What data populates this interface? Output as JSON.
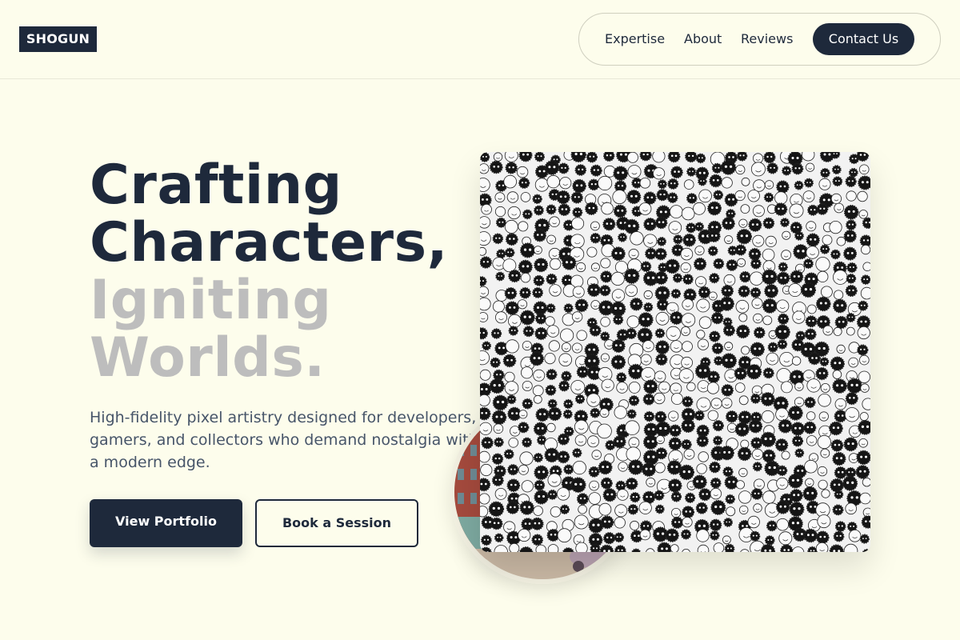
{
  "brand": {
    "logo_text": "SHOGUN"
  },
  "nav": {
    "items": [
      "Expertise",
      "About",
      "Reviews"
    ],
    "contact_label": "Contact Us"
  },
  "hero": {
    "headline_dark": [
      "Crafting",
      "Characters,"
    ],
    "headline_light": [
      "Igniting",
      "Worlds."
    ],
    "subtitle": "High-fidelity pixel artistry designed for developers, gamers, and collectors who demand nostalgia with a modern edge.",
    "primary_cta": "View Portfolio",
    "secondary_cta": "Book a Session"
  },
  "colors": {
    "background": "#fdfdec",
    "primary": "#1e293b",
    "muted_headline": "#bdbdbd",
    "body_text": "#475569"
  }
}
